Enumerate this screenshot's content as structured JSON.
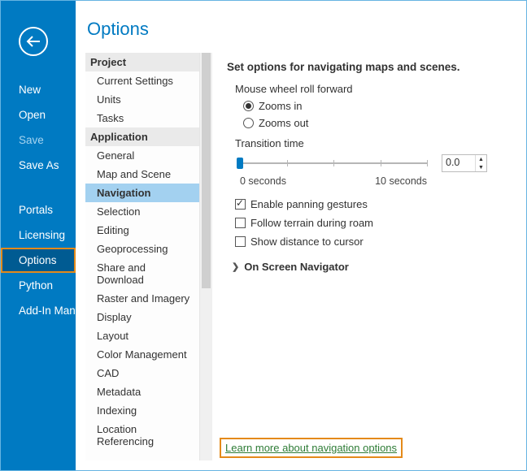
{
  "leftNav": {
    "items": [
      {
        "label": "New",
        "dim": false
      },
      {
        "label": "Open",
        "dim": false
      },
      {
        "label": "Save",
        "dim": true
      },
      {
        "label": "Save As",
        "dim": false
      },
      {
        "sep": true
      },
      {
        "label": "Portals",
        "dim": false
      },
      {
        "label": "Licensing",
        "dim": false
      },
      {
        "label": "Options",
        "dim": false,
        "selected": true
      },
      {
        "label": "Python",
        "dim": false
      },
      {
        "label": "Add-In Manager",
        "dim": false
      }
    ]
  },
  "paneTitle": "Options",
  "categories": {
    "projectHeader": "Project",
    "projectItems": [
      "Current Settings",
      "Units",
      "Tasks"
    ],
    "appHeader": "Application",
    "appItems": [
      "General",
      "Map and Scene",
      "Navigation",
      "Selection",
      "Editing",
      "Geoprocessing",
      "Share and Download",
      "Raster and Imagery",
      "Display",
      "Layout",
      "Color Management",
      "CAD",
      "Metadata",
      "Indexing",
      "Location Referencing"
    ],
    "selected": "Navigation"
  },
  "detail": {
    "title": "Set options for navigating maps and scenes.",
    "wheelLabel": "Mouse wheel roll forward",
    "wheelOptions": {
      "zin": "Zooms in",
      "zout": "Zooms out"
    },
    "wheelSelected": "zin",
    "transitionLabel": "Transition time",
    "slider": {
      "min": "0 seconds",
      "max": "10 seconds",
      "value": "0.0"
    },
    "checks": {
      "pan": {
        "label": "Enable panning gestures",
        "checked": true
      },
      "terrain": {
        "label": "Follow terrain during roam",
        "checked": false
      },
      "dist": {
        "label": "Show distance to cursor",
        "checked": false
      }
    },
    "expander": "On Screen Navigator",
    "learn": "Learn more about navigation options"
  }
}
